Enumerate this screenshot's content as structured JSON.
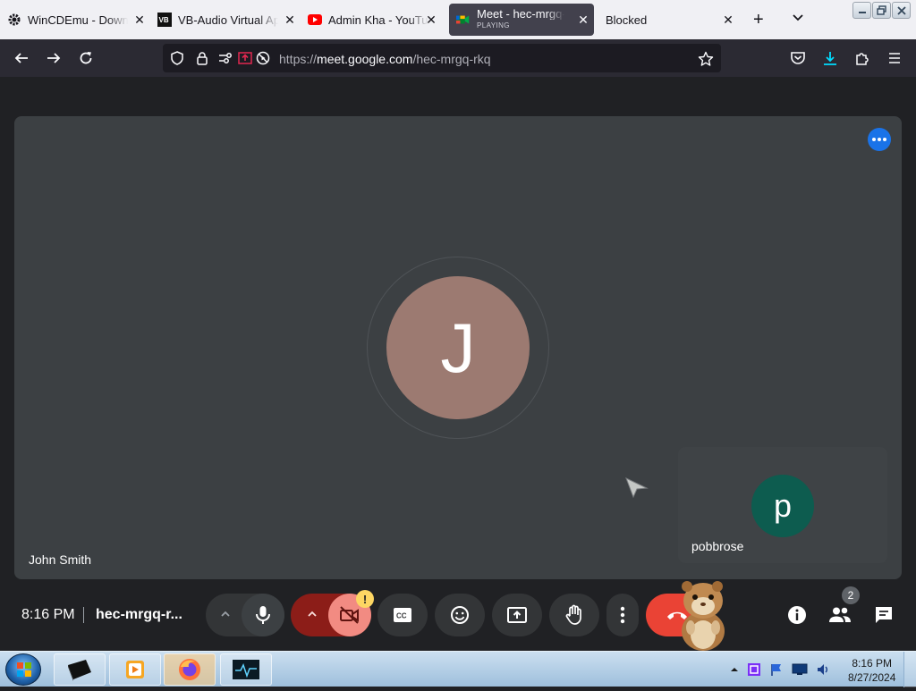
{
  "browser": {
    "tabs": [
      {
        "title": "WinCDEmu - Download",
        "icon": "gear-icon"
      },
      {
        "title": "VB-Audio Virtual Apps",
        "icon": "vb-logo-icon"
      },
      {
        "title": "Admin Kha - YouTube",
        "icon": "youtube-icon"
      },
      {
        "title": "Meet - hec-mrgq-rkq",
        "subtitle": "PLAYING",
        "icon": "meet-icon",
        "active": true
      },
      {
        "title": "Blocked",
        "icon": ""
      }
    ],
    "url": {
      "prefix": "https://",
      "host": "meet.google.com",
      "path": "/hec-mrgq-rkq"
    }
  },
  "meet": {
    "main_participant": {
      "initial": "J",
      "name": "John Smith",
      "avatar_color": "#9c7a71"
    },
    "self_participant": {
      "initial": "p",
      "name": "pobbrose",
      "avatar_color": "#0d5c4f"
    },
    "time": "8:16 PM",
    "meeting_code": "hec-mrgq-r...",
    "camera_warning": "!",
    "people_count": "2",
    "end_call_color": "#ea4335",
    "camera_off_color": "#f28b82"
  },
  "taskbar": {
    "time": "8:16 PM",
    "date": "8/27/2024"
  }
}
